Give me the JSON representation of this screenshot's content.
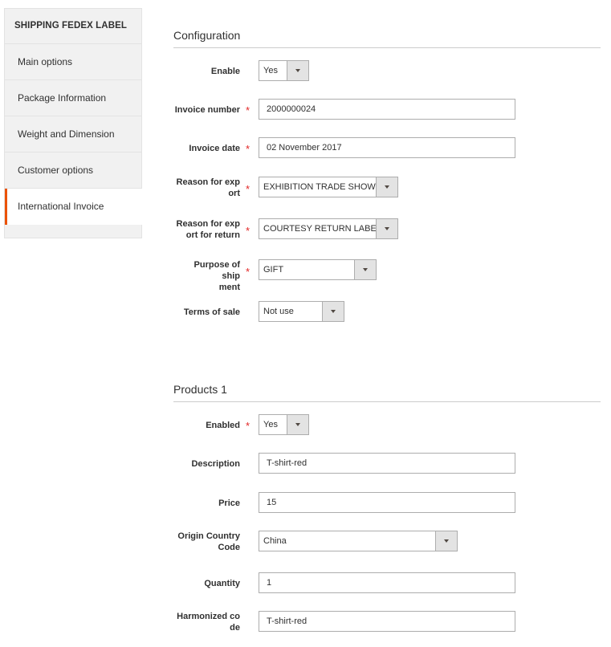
{
  "sidebar": {
    "title": "SHIPPING FEDEX LABEL",
    "items": [
      {
        "label": "Main options"
      },
      {
        "label": "Package Information"
      },
      {
        "label": "Weight and Dimension"
      },
      {
        "label": "Customer options"
      },
      {
        "label": "International Invoice"
      }
    ]
  },
  "configuration": {
    "title": "Configuration",
    "enable": {
      "label": "Enable",
      "value": "Yes"
    },
    "invoice_number": {
      "label": "Invoice number",
      "value": "2000000024"
    },
    "invoice_date": {
      "label": "Invoice date",
      "value": "02 November 2017"
    },
    "reason_export": {
      "label_1": "Reason for exp",
      "label_2": "ort",
      "value": "EXHIBITION TRADE SHOW"
    },
    "reason_return": {
      "label_1": "Reason for exp",
      "label_2": "ort for return",
      "value": "COURTESY RETURN LABEL"
    },
    "purpose": {
      "label_1": "Purpose of ship",
      "label_2": "ment",
      "value": "GIFT"
    },
    "terms": {
      "label": "Terms of sale",
      "value": "Not use"
    }
  },
  "products": {
    "title": "Products 1",
    "enabled": {
      "label": "Enabled",
      "value": "Yes"
    },
    "description": {
      "label": "Description",
      "value": "T-shirt-red"
    },
    "price": {
      "label": "Price",
      "value": "15"
    },
    "origin": {
      "label_1": "Origin Country",
      "label_2": "Code",
      "value": "China"
    },
    "quantity": {
      "label": "Quantity",
      "value": "1"
    },
    "harmonized": {
      "label_1": "Harmonized co",
      "label_2": "de",
      "value": "T-shirt-red"
    }
  },
  "required_mark": "*",
  "colors": {
    "accent": "#eb5202",
    "required": "#e22626"
  }
}
